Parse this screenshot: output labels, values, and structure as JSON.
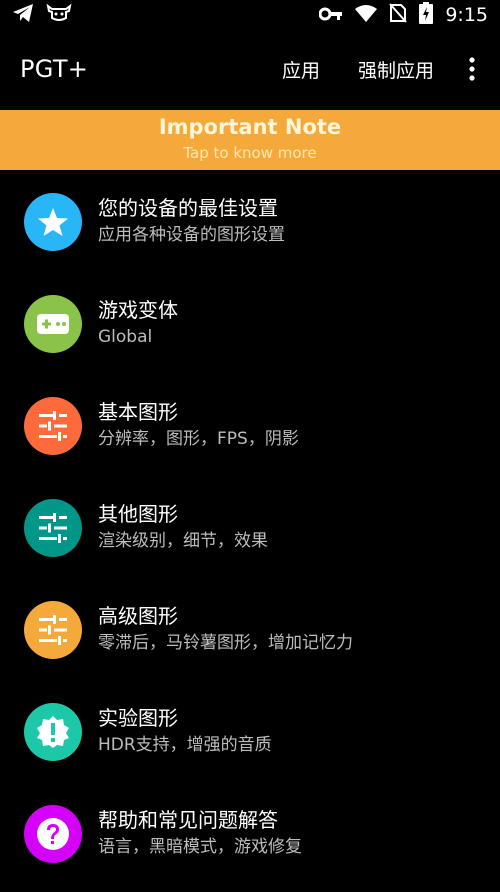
{
  "status_bar": {
    "time": "9:15",
    "icons": [
      "telegram-icon",
      "cow-icon",
      "key-icon",
      "wifi-icon",
      "no-sim-icon",
      "battery-charging-icon"
    ]
  },
  "appbar": {
    "title": "PGT+",
    "apply_label": "应用",
    "force_apply_label": "强制应用",
    "overflow_icon": "more-vert-icon"
  },
  "note": {
    "title": "Important Note",
    "subtitle": "Tap to know more",
    "color": "#F5A93B"
  },
  "menu": [
    {
      "title": "您的设备的最佳设置",
      "subtitle": "应用各种设备的图形设置",
      "icon": "star-icon",
      "color": "#29B6F6"
    },
    {
      "title": "游戏变体",
      "subtitle": "Global",
      "icon": "gamepad-icon",
      "color": "#8BC34A"
    },
    {
      "title": "基本图形",
      "subtitle": "分辨率，图形，FPS，阴影",
      "icon": "tune-icon",
      "color": "#FF6A3D"
    },
    {
      "title": "其他图形",
      "subtitle": "渲染级别，细节，效果",
      "icon": "tune-icon",
      "color": "#009688"
    },
    {
      "title": "高级图形",
      "subtitle": "零滞后，马铃薯图形，增加记忆力",
      "icon": "tune-icon",
      "color": "#F5A93B"
    },
    {
      "title": "实验图形",
      "subtitle": "HDR支持，增强的音质",
      "icon": "new-badge-icon",
      "color": "#1DC8A8"
    },
    {
      "title": "帮助和常见问题解答",
      "subtitle": "语言，黑暗模式，游戏修复",
      "icon": "help-icon",
      "color": "#D500F9"
    }
  ]
}
